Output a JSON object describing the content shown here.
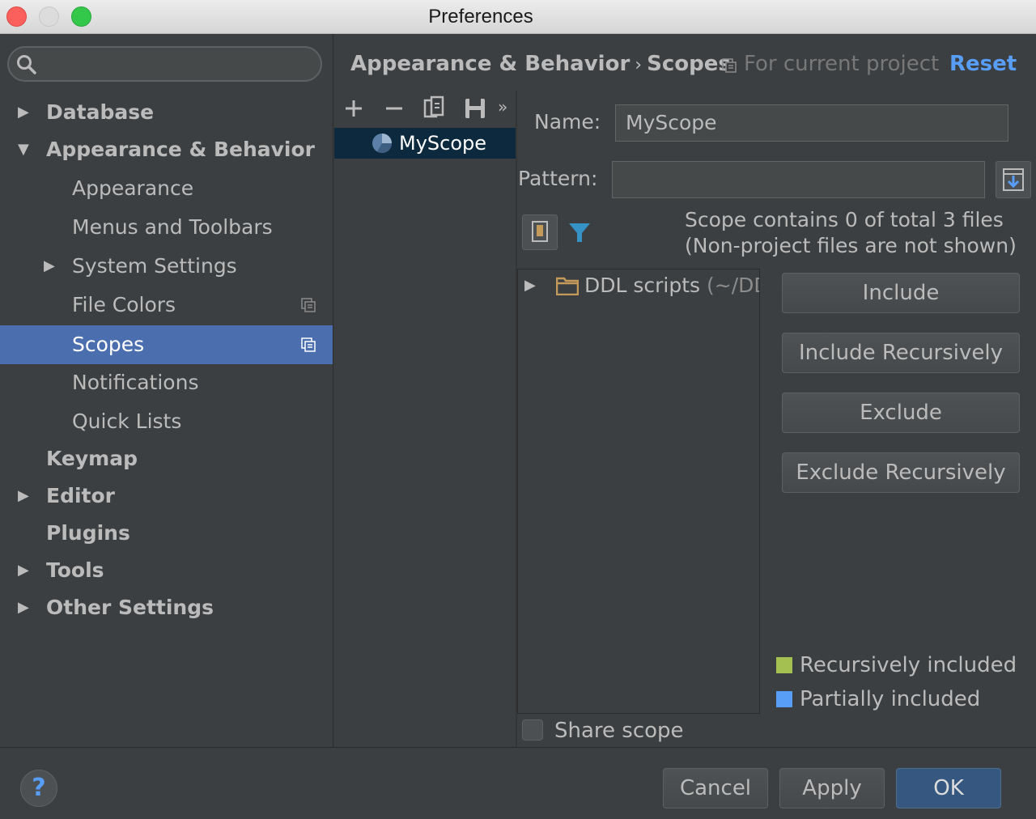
{
  "window": {
    "title": "Preferences"
  },
  "search": {
    "placeholder": ""
  },
  "sidebar": {
    "items": [
      {
        "label": "Database"
      },
      {
        "label": "Appearance & Behavior"
      },
      {
        "label": "Appearance"
      },
      {
        "label": "Menus and Toolbars"
      },
      {
        "label": "System Settings"
      },
      {
        "label": "File Colors"
      },
      {
        "label": "Scopes"
      },
      {
        "label": "Notifications"
      },
      {
        "label": "Quick Lists"
      },
      {
        "label": "Keymap"
      },
      {
        "label": "Editor"
      },
      {
        "label": "Plugins"
      },
      {
        "label": "Tools"
      },
      {
        "label": "Other Settings"
      }
    ]
  },
  "header": {
    "breadcrumb_parent": "Appearance & Behavior",
    "breadcrumb_sep": "›",
    "breadcrumb_current": "Scopes",
    "for_current_project": "For current project",
    "reset": "Reset"
  },
  "toolbar": {
    "more": "»"
  },
  "scopes": [
    {
      "label": "MyScope"
    }
  ],
  "editor": {
    "name_label": "Name:",
    "name_value": "MyScope",
    "pattern_label": "Pattern:",
    "pattern_value": "",
    "info_line1": "Scope contains 0 of total 3 files",
    "info_line2": "(Non-project files are not shown)"
  },
  "filetree": {
    "folder": "DDL scripts",
    "path": " (~/DDL"
  },
  "actions": {
    "include": "Include",
    "include_recursively": "Include Recursively",
    "exclude": "Exclude",
    "exclude_recursively": "Exclude Recursively"
  },
  "legend": {
    "recursive": "Recursively included",
    "partial": "Partially included",
    "recursive_color": "#a4c051",
    "partial_color": "#589df6"
  },
  "share": {
    "label": "Share scope",
    "checked": false
  },
  "footer": {
    "help": "?",
    "cancel": "Cancel",
    "apply": "Apply",
    "ok": "OK"
  },
  "icons": [
    "search-icon",
    "add-icon",
    "remove-icon",
    "copy-icon",
    "save-icon",
    "scope-icon",
    "folder-icon",
    "filter-icon",
    "quick-add-icon",
    "project-icon"
  ]
}
